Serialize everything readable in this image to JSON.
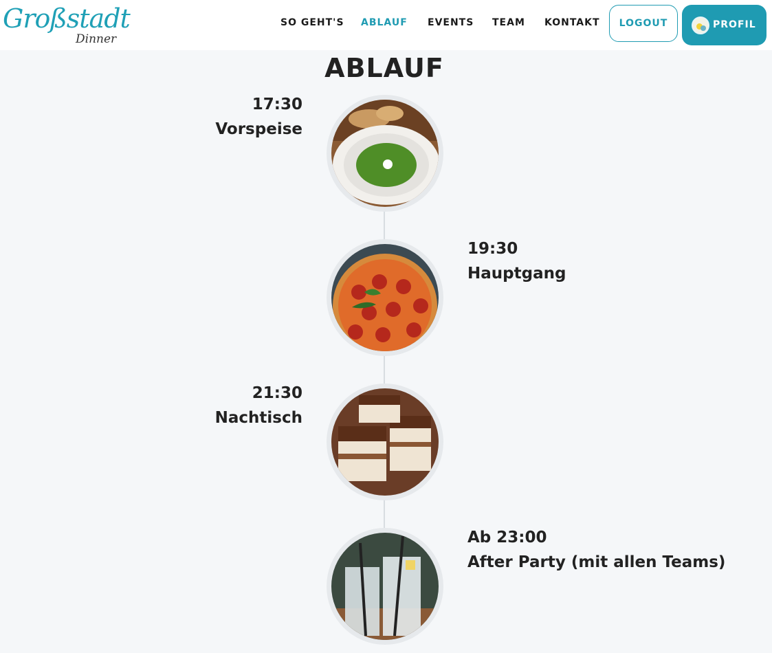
{
  "logo": {
    "big": "Großstadt",
    "small": "Dinner"
  },
  "nav": {
    "items": [
      {
        "label": "SO GEHT'S"
      },
      {
        "label": "ABLAUF"
      },
      {
        "label": "EVENTS"
      },
      {
        "label": "TEAM"
      },
      {
        "label": "KONTAKT"
      }
    ],
    "active": "ABLAUF",
    "logout_label": "LOGOUT",
    "profil_label": "PROFIL"
  },
  "page": {
    "title": "ABLAUF"
  },
  "schedule": [
    {
      "time": "17:30",
      "label": "Vorspeise",
      "image": "soup-bowl-image"
    },
    {
      "time": "19:30",
      "label": "Hauptgang",
      "image": "pepperoni-pizza-image"
    },
    {
      "time": "21:30",
      "label": "Nachtisch",
      "image": "tiramisu-image"
    },
    {
      "time": "Ab 23:00",
      "label": "After Party (mit allen Teams)",
      "image": "drinks-image"
    }
  ],
  "colors": {
    "accent": "#1f9bb2",
    "background": "#f5f7f9",
    "text": "#222222"
  }
}
